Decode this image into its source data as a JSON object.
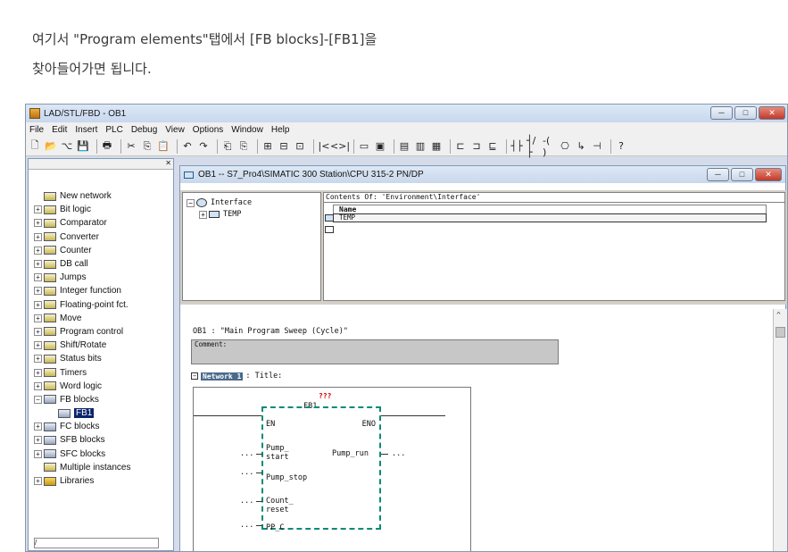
{
  "article": {
    "line1": "여기서 \"Program elements\"탭에서 [FB blocks]-[FB1]을",
    "line2": "찾아들어가면 됩니다."
  },
  "app": {
    "title": "LAD/STL/FBD  - OB1",
    "menu": [
      "File",
      "Edit",
      "Insert",
      "PLC",
      "Debug",
      "View",
      "Options",
      "Window",
      "Help"
    ],
    "toolbar_icons": [
      "new-icon",
      "open-icon",
      "network-icon",
      "save-icon",
      "sep",
      "print-icon",
      "sep",
      "cut-icon",
      "copy-icon",
      "paste-icon",
      "sep",
      "undo-icon",
      "redo-icon",
      "sep",
      "load-icon",
      "download-icon",
      "sep",
      "monitor-icon",
      "compare-icon",
      "go-online-icon",
      "sep",
      "first-icon",
      "last-icon",
      "sep",
      "view-lad-icon",
      "view-stl-icon",
      "sep",
      "view-fbd-icon",
      "view-table-icon",
      "view-col-icon",
      "sep",
      "overview-icon",
      "details-icon",
      "catalog-icon",
      "sep",
      "contact-icon",
      "contact-neg-icon",
      "coil-icon",
      "box-icon",
      "branch-open-icon",
      "branch-close-icon",
      "sep",
      "help-icon"
    ],
    "toolbar_glyphs": [
      "🗋",
      "📂",
      "⌥",
      "💾",
      "",
      "🖶",
      "",
      "✂",
      "⎘",
      "📋",
      "",
      "↶",
      "↷",
      "",
      "⎗",
      "⎘",
      "",
      "⊞",
      "⊟",
      "⊡",
      "",
      "|<",
      "<>|",
      "",
      "▭",
      "▣",
      "",
      "▤",
      "▥",
      "▦",
      "",
      "⊏",
      "⊐",
      "⊑",
      "",
      "┤├",
      "┤/├",
      "-( )",
      "⎔",
      "↳",
      "⊣",
      "",
      "?"
    ],
    "window_buttons": {
      "minimize": "─",
      "maximize": "□",
      "close": "✕"
    }
  },
  "catalog": {
    "close_label": "✕",
    "items": [
      {
        "label": "New network",
        "expander": "",
        "icon": "NET",
        "selected": false,
        "indent": 0
      },
      {
        "label": "Bit logic",
        "expander": "+",
        "icon": "BIT",
        "selected": false,
        "indent": 0
      },
      {
        "label": "Comparator",
        "expander": "+",
        "icon": "CMP",
        "selected": false,
        "indent": 0
      },
      {
        "label": "Converter",
        "expander": "+",
        "icon": "CNV",
        "selected": false,
        "indent": 0
      },
      {
        "label": "Counter",
        "expander": "+",
        "icon": "CNT",
        "selected": false,
        "indent": 0
      },
      {
        "label": "DB call",
        "expander": "+",
        "icon": "DB",
        "selected": false,
        "indent": 0
      },
      {
        "label": "Jumps",
        "expander": "+",
        "icon": "JMP",
        "selected": false,
        "indent": 0
      },
      {
        "label": "Integer function",
        "expander": "+",
        "icon": "INT",
        "selected": false,
        "indent": 0
      },
      {
        "label": "Floating-point fct.",
        "expander": "+",
        "icon": "FP",
        "selected": false,
        "indent": 0
      },
      {
        "label": "Move",
        "expander": "+",
        "icon": "MOV",
        "selected": false,
        "indent": 0
      },
      {
        "label": "Program control",
        "expander": "+",
        "icon": "PC",
        "selected": false,
        "indent": 0
      },
      {
        "label": "Shift/Rotate",
        "expander": "+",
        "icon": "SHR",
        "selected": false,
        "indent": 0
      },
      {
        "label": "Status bits",
        "expander": "+",
        "icon": "ST",
        "selected": false,
        "indent": 0
      },
      {
        "label": "Timers",
        "expander": "+",
        "icon": "TMR",
        "selected": false,
        "indent": 0
      },
      {
        "label": "Word logic",
        "expander": "+",
        "icon": "WL",
        "selected": false,
        "indent": 0
      },
      {
        "label": "FB blocks",
        "expander": "−",
        "icon": "FB",
        "selected": false,
        "indent": 0
      },
      {
        "label": "FB1",
        "expander": "",
        "icon": "FB",
        "selected": true,
        "indent": 1
      },
      {
        "label": "FC blocks",
        "expander": "+",
        "icon": "FC",
        "selected": false,
        "indent": 0
      },
      {
        "label": "SFB blocks",
        "expander": "+",
        "icon": "SFB",
        "selected": false,
        "indent": 0
      },
      {
        "label": "SFC blocks",
        "expander": "+",
        "icon": "SFC",
        "selected": false,
        "indent": 0
      },
      {
        "label": "Multiple instances",
        "expander": "",
        "icon": "MI",
        "selected": false,
        "indent": 0
      },
      {
        "label": "Libraries",
        "expander": "+",
        "icon": "LIB",
        "selected": false,
        "indent": 0
      }
    ],
    "bottom_text": "/"
  },
  "editor_window": {
    "title": "OB1 -- S7_Pro4\\SIMATIC 300 Station\\CPU 315-2 PN/DP",
    "interface_tree": {
      "root": "Interface",
      "child": "TEMP"
    },
    "contents_of": "Contents Of: 'Environment\\Interface'",
    "table_header": "Name",
    "table_rows": [
      "TEMP",
      ""
    ],
    "ob_title": "OB1 :  \"Main Program Sweep (Cycle)\"",
    "comment_label": "Comment:",
    "network_label": "Network 1",
    "network_title": ": Title:",
    "fb": {
      "instance": "???",
      "name": "FB1",
      "en": "EN",
      "eno": "ENO",
      "inputs": [
        "Pump_\nstart",
        "Pump_stop",
        "Count_\nreset",
        "PP_C"
      ],
      "output": "Pump_run",
      "placeholder": "..."
    }
  }
}
